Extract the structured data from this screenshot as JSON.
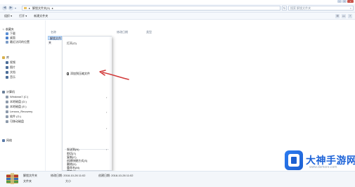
{
  "window": {
    "controls": [
      "–",
      "□",
      "x"
    ]
  },
  "address_bar": {
    "path_segments": [
      "▸",
      "解锁文件夹(5)",
      "▸"
    ],
    "refresh_glyph": "↻",
    "search_placeholder": "搜索 解锁文件夹",
    "search_icon_glyph": "⌕"
  },
  "toolbar": {
    "items": [
      "组织 ▾",
      "打开 ▾",
      "新建文件夹"
    ],
    "right_icons": [
      "☰",
      "▭",
      "?"
    ]
  },
  "sidebar": {
    "favorites_header": "☆ 收藏夹",
    "favorites": [
      "下载",
      "桌面",
      "最近访问的位置"
    ],
    "libraries_header": "库",
    "libraries": [
      "视频",
      "图片",
      "文档",
      "音乐"
    ],
    "computer_header": "计算机",
    "drives": [
      "Windows7 (C:)",
      "本地磁盘 (D:)",
      "本地磁盘 (E:)",
      "Lenovo_Recovery",
      "软件 (G:)",
      "可移动磁盘"
    ],
    "network_header": "网络"
  },
  "file_list": {
    "columns": [
      "名称",
      "修改日期",
      "类型"
    ],
    "selected_row": "解锁文件夹"
  },
  "context_menu": {
    "items": [
      {
        "label": "打开(O)",
        "has_arrow": false
      },
      {
        "label": "",
        "has_arrow": false
      },
      {
        "label": "",
        "has_arrow": false
      },
      {
        "label": "",
        "has_arrow": false
      },
      {
        "label": "添加到压缩文件",
        "has_arrow": false,
        "icon": "lock-icon"
      },
      {
        "label": "",
        "has_arrow": false
      },
      {
        "label": "",
        "has_arrow": true
      },
      {
        "label": "",
        "has_arrow": true
      },
      {
        "label": "",
        "has_arrow": true
      },
      {
        "label": "",
        "has_arrow": false
      },
      {
        "label": "发送到(N)",
        "has_arrow": true
      },
      {
        "label": "剪切(T)",
        "has_arrow": false
      },
      {
        "label": "复制(C)",
        "has_arrow": false
      },
      {
        "label": "创建快捷方式(S)",
        "has_arrow": false
      },
      {
        "label": "删除(D)",
        "has_arrow": false
      },
      {
        "label": "重命名(M)",
        "has_arrow": false
      },
      {
        "label": "属性(R)",
        "has_arrow": false
      }
    ]
  },
  "details_pane": {
    "name": "解锁文件夹",
    "type": "文件夹",
    "modified_label": "修改日期: 2018-10-26 11:02",
    "created_label": "创建日期: 2018-10-26 11:02",
    "size_label": "大小"
  },
  "watermark": {
    "title": "大神手游网",
    "url": "www.dsmore.com"
  },
  "colors": {
    "selection": "#cfe3fb",
    "annotation_arrow": "#d23a3a",
    "watermark_blue": "#1d63d8"
  }
}
